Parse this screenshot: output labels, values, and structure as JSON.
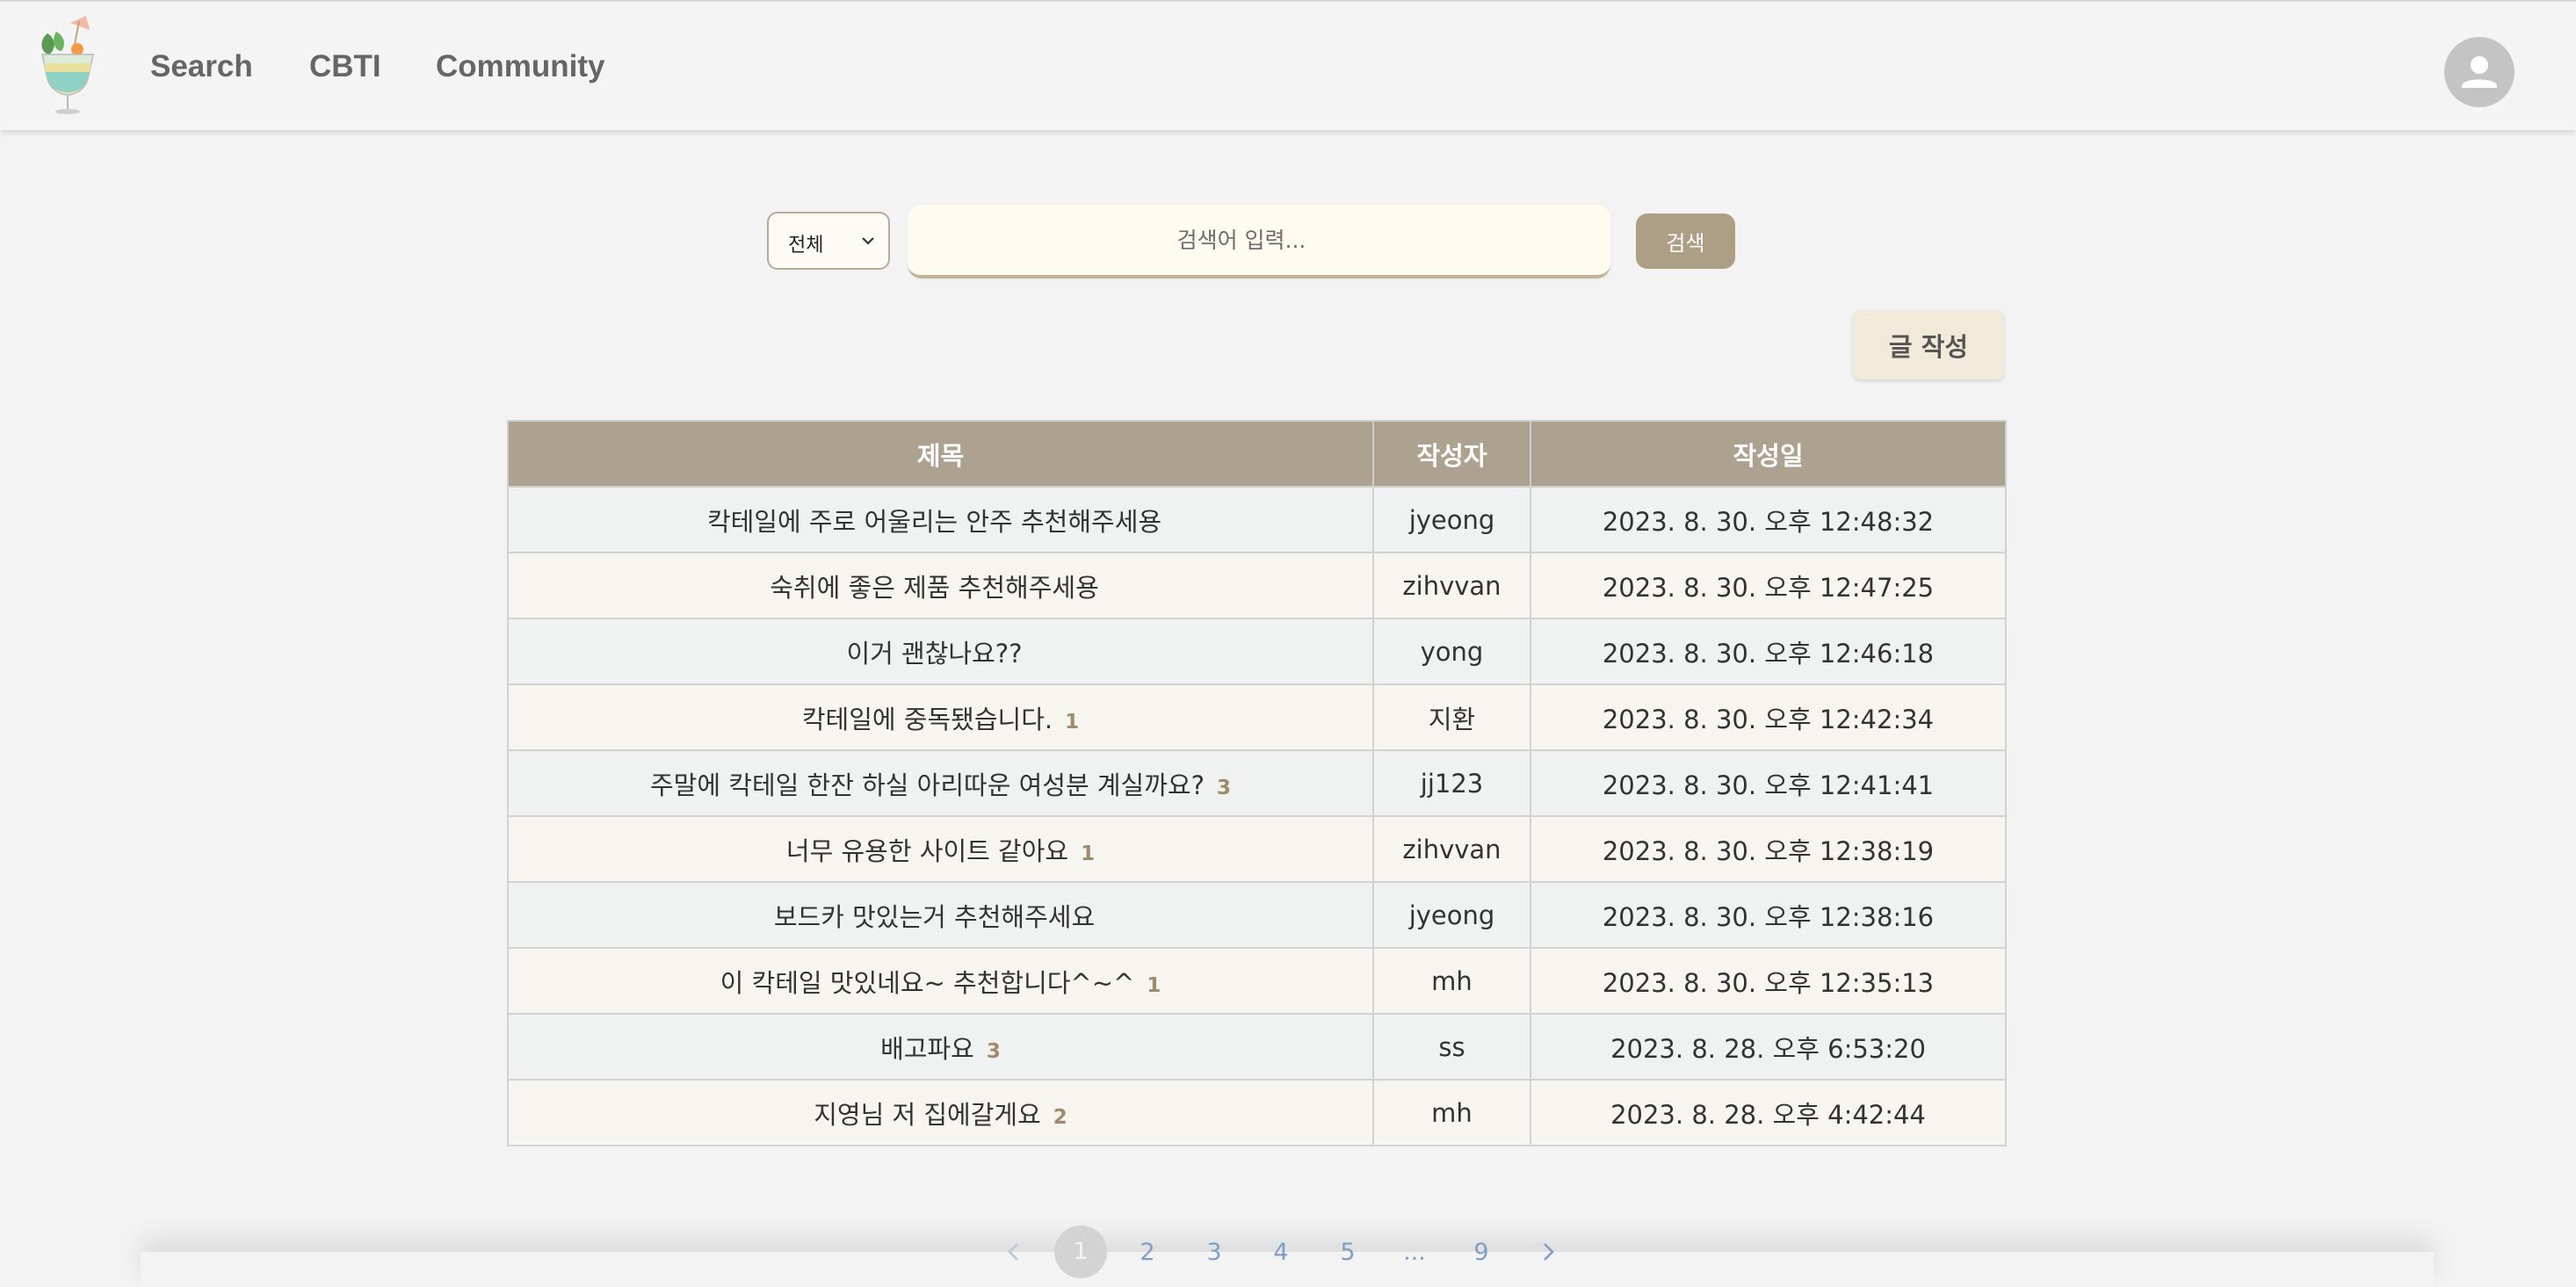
{
  "nav": {
    "logo_icon": "cocktail-glass-icon",
    "items": [
      {
        "label": "Search"
      },
      {
        "label": "CBTI"
      },
      {
        "label": "Community"
      }
    ],
    "avatar_icon": "user-avatar-icon"
  },
  "search": {
    "category_value": "전체",
    "placeholder": "검색어 입력...",
    "button_label": "검색"
  },
  "write_button_label": "글 작성",
  "table": {
    "headers": [
      "제목",
      "작성자",
      "작성일"
    ],
    "rows": [
      {
        "title": "칵테일에 주로 어울리는 안주 추천해주세용",
        "comments": "",
        "author": "jyeong",
        "date": "2023. 8. 30. 오후 12:48:32"
      },
      {
        "title": "숙취에 좋은 제품 추천해주세용",
        "comments": "",
        "author": "zihvvan",
        "date": "2023. 8. 30. 오후 12:47:25"
      },
      {
        "title": "이거 괜찮나요??",
        "comments": "",
        "author": "yong",
        "date": "2023. 8. 30. 오후 12:46:18"
      },
      {
        "title": "칵테일에 중독됐습니다.",
        "comments": "1",
        "author": "지환",
        "date": "2023. 8. 30. 오후 12:42:34"
      },
      {
        "title": "주말에 칵테일 한잔 하실 아리따운 여성분 계실까요?",
        "comments": "3",
        "author": "jj123",
        "date": "2023. 8. 30. 오후 12:41:41"
      },
      {
        "title": "너무 유용한 사이트 같아요",
        "comments": "1",
        "author": "zihvvan",
        "date": "2023. 8. 30. 오후 12:38:19"
      },
      {
        "title": "보드카 맛있는거 추천해주세요",
        "comments": "",
        "author": "jyeong",
        "date": "2023. 8. 30. 오후 12:38:16"
      },
      {
        "title": "이 칵테일 맛있네요~ 추천합니다^~^",
        "comments": "1",
        "author": "mh",
        "date": "2023. 8. 30. 오후 12:35:13"
      },
      {
        "title": "배고파요",
        "comments": "3",
        "author": "ss",
        "date": "2023. 8. 28. 오후 6:53:20"
      },
      {
        "title": "지영님 저 집에갈게요",
        "comments": "2",
        "author": "mh",
        "date": "2023. 8. 28. 오후 4:42:44"
      }
    ]
  },
  "pagination": {
    "pages": [
      "1",
      "2",
      "3",
      "4",
      "5",
      "...",
      "9"
    ],
    "current": "1",
    "prev_icon": "chevron-left-icon",
    "next_icon": "chevron-right-icon"
  }
}
